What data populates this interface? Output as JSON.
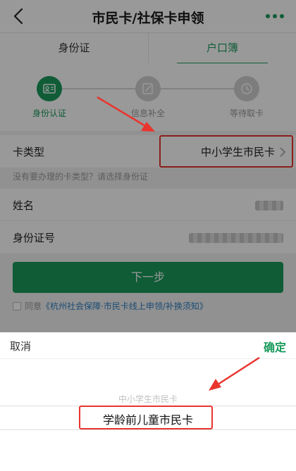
{
  "header": {
    "title": "市民卡/社保卡申领",
    "back_icon": "back-arrow-icon",
    "more_icon": "more-dots-icon"
  },
  "tabs": [
    {
      "label": "身份证"
    },
    {
      "label": "户口簿",
      "active": true
    }
  ],
  "steps": [
    {
      "label": "身份认证",
      "icon": "id-card-icon",
      "active": true
    },
    {
      "label": "信息补全",
      "icon": "edit-icon",
      "active": false
    },
    {
      "label": "等待取卡",
      "icon": "clock-icon",
      "active": false
    }
  ],
  "form": {
    "card_type_label": "卡类型",
    "card_type_value": "中小学生市民卡",
    "hint": "没有要办理的卡类型？请选择身份证",
    "name_label": "姓名",
    "id_label": "身份证号"
  },
  "next_button": "下一步",
  "agreement": {
    "prefix": "同意",
    "link": "《杭州社会保障·市民卡线上申领/补换须知》"
  },
  "picker": {
    "cancel": "取消",
    "confirm": "确定",
    "options": [
      "中小学生市民卡",
      "学龄前儿童市民卡"
    ],
    "selected": "学龄前儿童市民卡"
  },
  "colors": {
    "accent": "#1a9a5c",
    "highlight": "#e8352e",
    "link": "#2f7fc1"
  }
}
